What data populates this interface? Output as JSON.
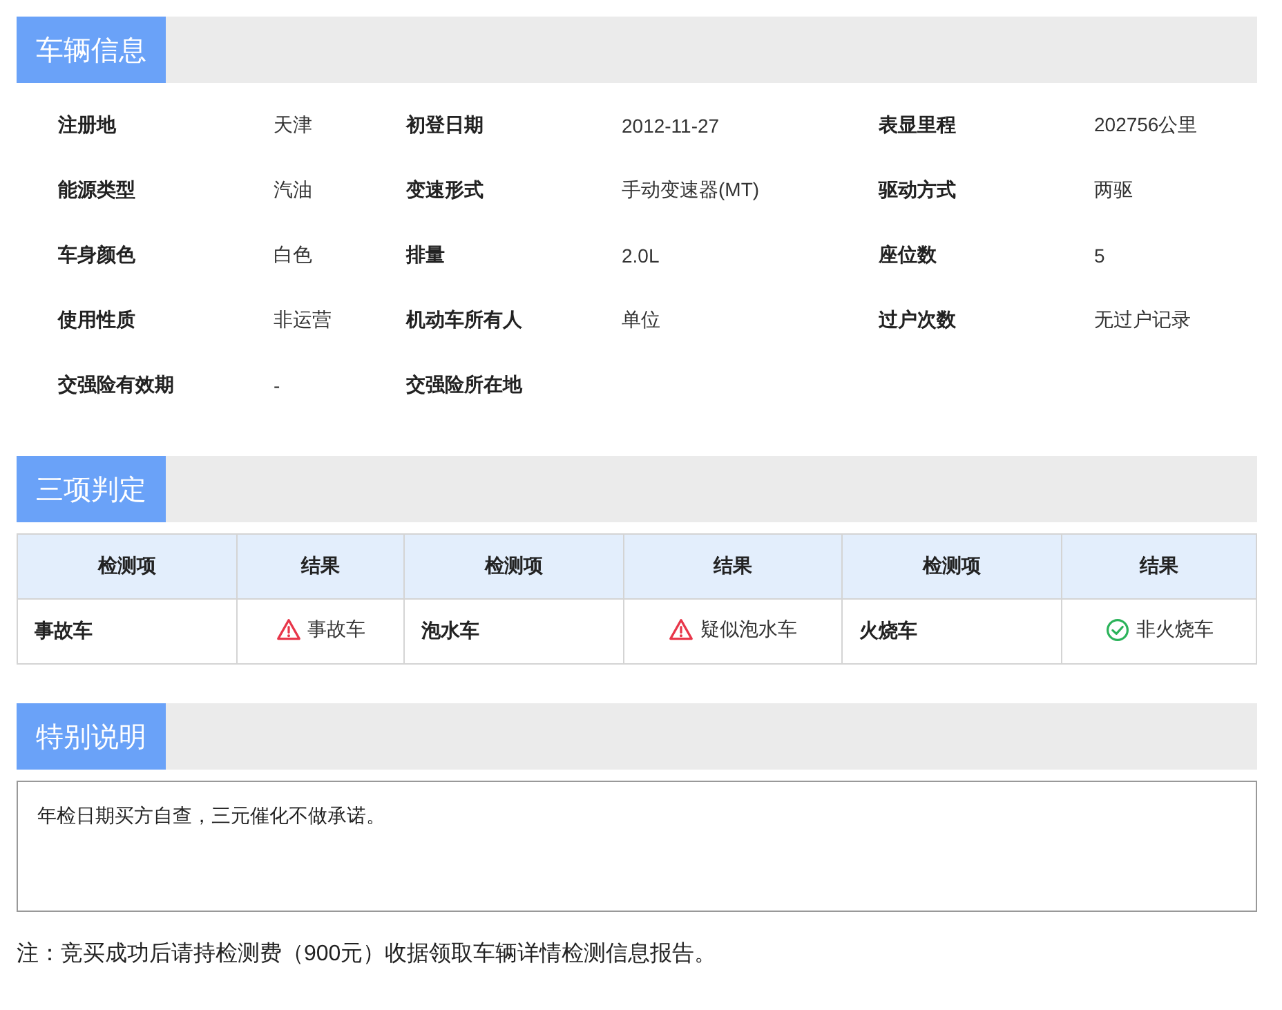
{
  "vehicle_info": {
    "title": "车辆信息",
    "fields": [
      {
        "label": "注册地",
        "value": "天津"
      },
      {
        "label": "初登日期",
        "value": "2012-11-27"
      },
      {
        "label": "表显里程",
        "value": "202756公里"
      },
      {
        "label": "能源类型",
        "value": "汽油"
      },
      {
        "label": "变速形式",
        "value": "手动变速器(MT)"
      },
      {
        "label": "驱动方式",
        "value": "两驱"
      },
      {
        "label": "车身颜色",
        "value": "白色"
      },
      {
        "label": "排量",
        "value": "2.0L"
      },
      {
        "label": "座位数",
        "value": "5"
      },
      {
        "label": "使用性质",
        "value": "非运营"
      },
      {
        "label": "机动车所有人",
        "value": "单位"
      },
      {
        "label": "过户次数",
        "value": "无过户记录"
      },
      {
        "label": "交强险有效期",
        "value": "-"
      },
      {
        "label": "交强险所在地"
      }
    ]
  },
  "judgement": {
    "title": "三项判定",
    "columns": [
      "检测项",
      "结果",
      "检测项",
      "结果",
      "检测项",
      "结果"
    ],
    "rows": [
      {
        "items": [
          {
            "name": "事故车",
            "result": "事故车",
            "kind": "warning"
          },
          {
            "name": "泡水车",
            "result": "疑似泡水车",
            "kind": "warning"
          },
          {
            "name": "火烧车",
            "result": "非火烧车",
            "kind": "ok"
          }
        ]
      }
    ]
  },
  "special_notes": {
    "title": "特别说明",
    "text": "年检日期买方自查，三元催化不做承诺。"
  },
  "footnote": "注：竞买成功后请持检测费（900元）收据领取车辆详情检测信息报告。"
}
